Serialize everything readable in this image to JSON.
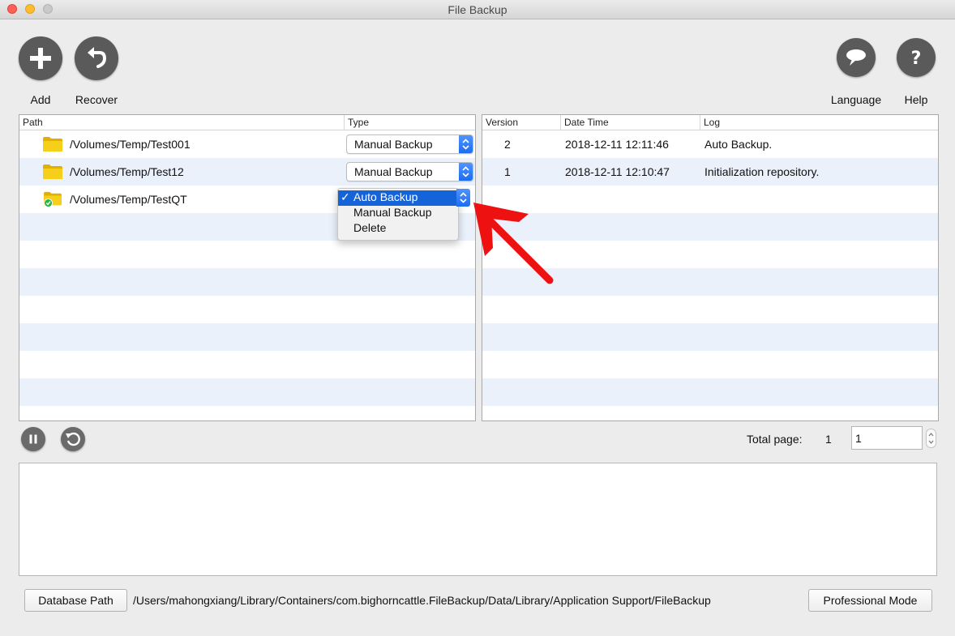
{
  "window": {
    "title": "File Backup"
  },
  "colors": {
    "close": "#fe5f57",
    "minimize": "#febc2e",
    "zoom": "#c9c9c9",
    "accent": "#1463d8",
    "arrow": "#ee1111"
  },
  "toolbar": {
    "add_label": "Add",
    "recover_label": "Recover",
    "language_label": "Language",
    "help_label": "Help"
  },
  "paths_table": {
    "headers": {
      "path": "Path",
      "type": "Type"
    },
    "rows": [
      {
        "path": "/Volumes/Temp/Test001",
        "type": "Manual Backup",
        "icon": "folder-icon"
      },
      {
        "path": "/Volumes/Temp/Test12",
        "type": "Manual Backup",
        "icon": "folder-icon"
      },
      {
        "path": "/Volumes/Temp/TestQT",
        "type": "Auto Backup",
        "icon": "folder-check-icon"
      }
    ],
    "type_options": [
      "Auto Backup",
      "Manual Backup",
      "Delete"
    ],
    "checkmark": "✓"
  },
  "versions_table": {
    "headers": {
      "version": "Version",
      "datetime": "Date Time",
      "log": "Log"
    },
    "rows": [
      {
        "version": "2",
        "datetime": "2018-12-11 12:11:46",
        "log": "Auto Backup."
      },
      {
        "version": "1",
        "datetime": "2018-12-11 12:10:47",
        "log": "Initialization repository."
      }
    ]
  },
  "pager": {
    "total_label": "Total page:",
    "total_value": "1",
    "current_page": "1"
  },
  "footer": {
    "database_button": "Database Path",
    "database_path": "/Users/mahongxiang/Library/Containers/com.bighorncattle.FileBackup/Data/Library/Application Support/FileBackup",
    "professional_button": "Professional Mode"
  }
}
